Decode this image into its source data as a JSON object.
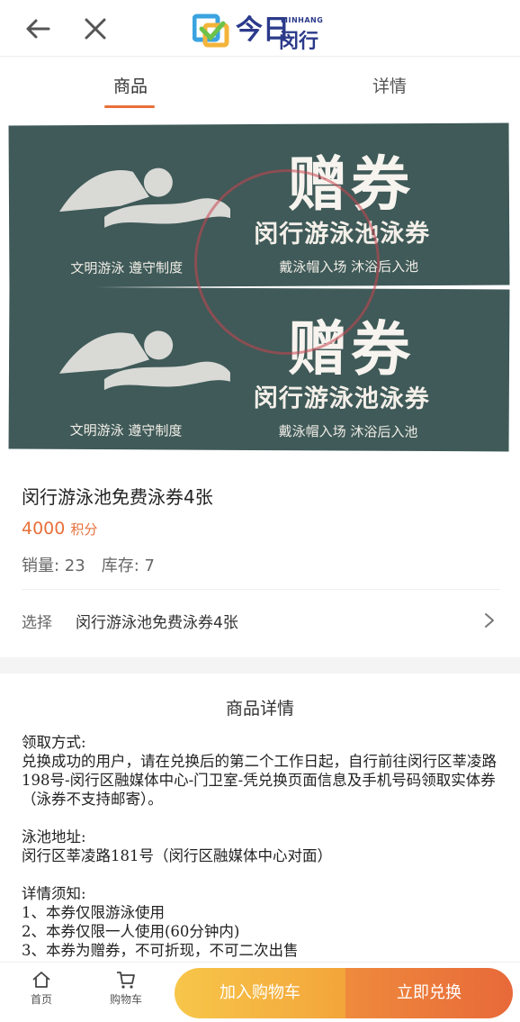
{
  "header": {
    "logo_text_cn": "今日",
    "logo_brand_en": "MINHANG",
    "logo_brand_cn": "闵行",
    "icons": [
      "back-arrow-icon",
      "close-icon"
    ]
  },
  "tabs": [
    {
      "label": "商品",
      "active": true
    },
    {
      "label": "详情",
      "active": false
    }
  ],
  "banner": {
    "tickets": [
      {
        "big_text": "赠券",
        "title": "闵行游泳池泳券",
        "left_slogan": "文明游泳  遵守制度",
        "right_slogan": "戴泳帽入场  沐浴后入池"
      },
      {
        "big_text": "赠券",
        "title": "闵行游泳池泳券",
        "left_slogan": "文明游泳  遵守制度",
        "right_slogan": "戴泳帽入场  沐浴后入池"
      }
    ],
    "ticket_color": "#3f5a58"
  },
  "product": {
    "name": "闵行游泳池免费泳券4张",
    "price": "4000",
    "price_unit": "积分",
    "sales": "销量: 23",
    "stock": "库存: 7",
    "select_label": "选择",
    "select_value": "闵行游泳池免费泳券4张"
  },
  "detail": {
    "title": "商品详情",
    "lines": {
      "l1": "领取方式:",
      "l2": "兑换成功的用户，请在兑换后的第二个工作日起，自行前往闵行区莘凌路198号-闵行区融媒体中心-门卫室-凭兑换页面信息及手机号码领取实体券（泳券不支持邮寄）。",
      "l3": "泳池地址:",
      "l4": "闵行区莘凌路181号（闵行区融媒体中心对面）",
      "l5": "详情须知:",
      "l6": "1、本券仅限游泳使用",
      "l7": "2、本券仅限一人使用(60分钟内)",
      "l8": "3、本券为赠券，不可折现，不可二次出售"
    }
  },
  "bottom": {
    "home_label": "首页",
    "cart_label": "购物车",
    "add_cart_button": "加入购物车",
    "buy_button": "立即兑换"
  },
  "colors": {
    "accent": "#e8703a",
    "brand": "#2b3a8a"
  }
}
